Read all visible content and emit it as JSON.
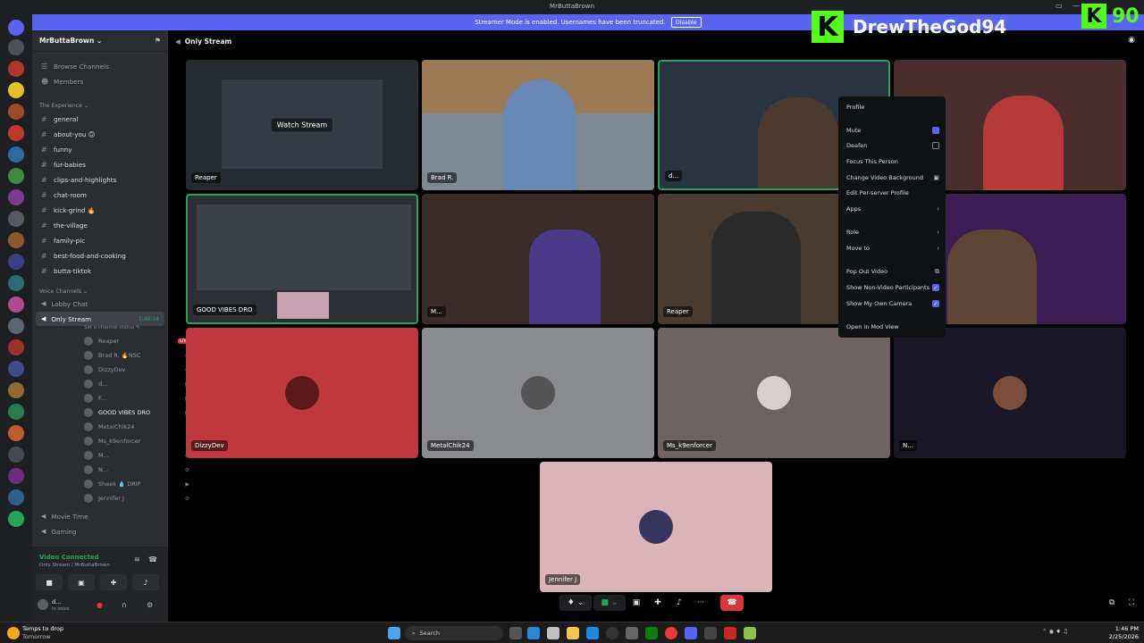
{
  "window": {
    "title": "MrButtaBrown"
  },
  "banner": {
    "text": "Streamer Mode is enabled. Usernames have been truncated.",
    "button": "Disable"
  },
  "overlay": {
    "username": "DrewTheGod94",
    "logo_letter": "K",
    "count": "90"
  },
  "server": {
    "name": "MrButtaBrown ⌄"
  },
  "sidebar": {
    "top_items": [
      {
        "label": "Browse Channels"
      },
      {
        "label": "Members"
      }
    ],
    "category1": "The Experience ⌄",
    "channels": [
      {
        "label": "general"
      },
      {
        "label": "about-you 🙃"
      },
      {
        "label": "funny"
      },
      {
        "label": "fur-babies"
      },
      {
        "label": "clips-and-highlights"
      },
      {
        "label": "chat-room"
      },
      {
        "label": "kick-grind 🔥"
      },
      {
        "label": "the-village"
      },
      {
        "label": "family-pic"
      },
      {
        "label": "best-food-and-cooking"
      },
      {
        "label": "butta-tiktok"
      }
    ],
    "category2": "Voice Channels ⌄",
    "voice": {
      "lobby": "Lobby Chat",
      "active": "Only Stream",
      "active_time": "1:40:14",
      "status_hint": "Set a channel status ✎"
    },
    "users": [
      {
        "name": "Reaper",
        "live": "LIVE"
      },
      {
        "name": "Brad R. 🔥NSC"
      },
      {
        "name": "DizzyDev"
      },
      {
        "name": "d..."
      },
      {
        "name": "F..."
      },
      {
        "name": "GOOD VIBES DRO"
      },
      {
        "name": "MetalChik24"
      },
      {
        "name": "Ms_k9enforcer"
      },
      {
        "name": "M..."
      },
      {
        "name": "N..."
      },
      {
        "name": "Sheek 💧 DRIP"
      },
      {
        "name": "Jennifer J"
      }
    ],
    "other_voice": [
      {
        "label": "Movie Time"
      },
      {
        "label": "Gaming"
      }
    ]
  },
  "voice_panel": {
    "title": "Video Connected",
    "subtitle": "Only Stream / MrButtaBrown",
    "me_name": "d...",
    "me_status": "In voice"
  },
  "channel_header": {
    "title": "Only Stream"
  },
  "tiles": [
    {
      "name": "Reaper",
      "watch": "Watch Stream"
    },
    {
      "name": "Brad R."
    },
    {
      "name": "d..."
    },
    {
      "name": ""
    },
    {
      "name": "GOOD VIBES DRO"
    },
    {
      "name": "M..."
    },
    {
      "name": "Reaper"
    },
    {
      "name": ""
    },
    {
      "name": "DizzyDev"
    },
    {
      "name": "MetalChik24"
    },
    {
      "name": "Ms_k9enforcer"
    },
    {
      "name": "N..."
    },
    {
      "name": "Jennifer J"
    }
  ],
  "tile_colors": {
    "dizzy": "#c0383f",
    "metal": "#8a8b8f",
    "ms": "#6e6262",
    "n": "#1a1826",
    "jennifer": "#d9b4b9"
  },
  "menu": {
    "items": [
      {
        "label": "Profile"
      },
      {
        "label": "Mute"
      },
      {
        "label": "Deafen"
      },
      {
        "label": "Focus This Person"
      },
      {
        "label": "Change Video Background"
      },
      {
        "label": "Edit Per-server Profile"
      },
      {
        "label": "Apps"
      },
      {
        "label": "Role"
      },
      {
        "label": "Move to"
      },
      {
        "label": "Pop Out Video"
      },
      {
        "label": "Show Non-Video Participants"
      },
      {
        "label": "Show My Own Camera"
      },
      {
        "label": "Open in Mod View"
      }
    ]
  },
  "taskbar": {
    "weather_line1": "Temps to drop",
    "weather_line2": "Tomorrow",
    "search": "Search",
    "time": "1:46 PM",
    "date": "2/25/2026"
  },
  "accent": "#5865f2"
}
